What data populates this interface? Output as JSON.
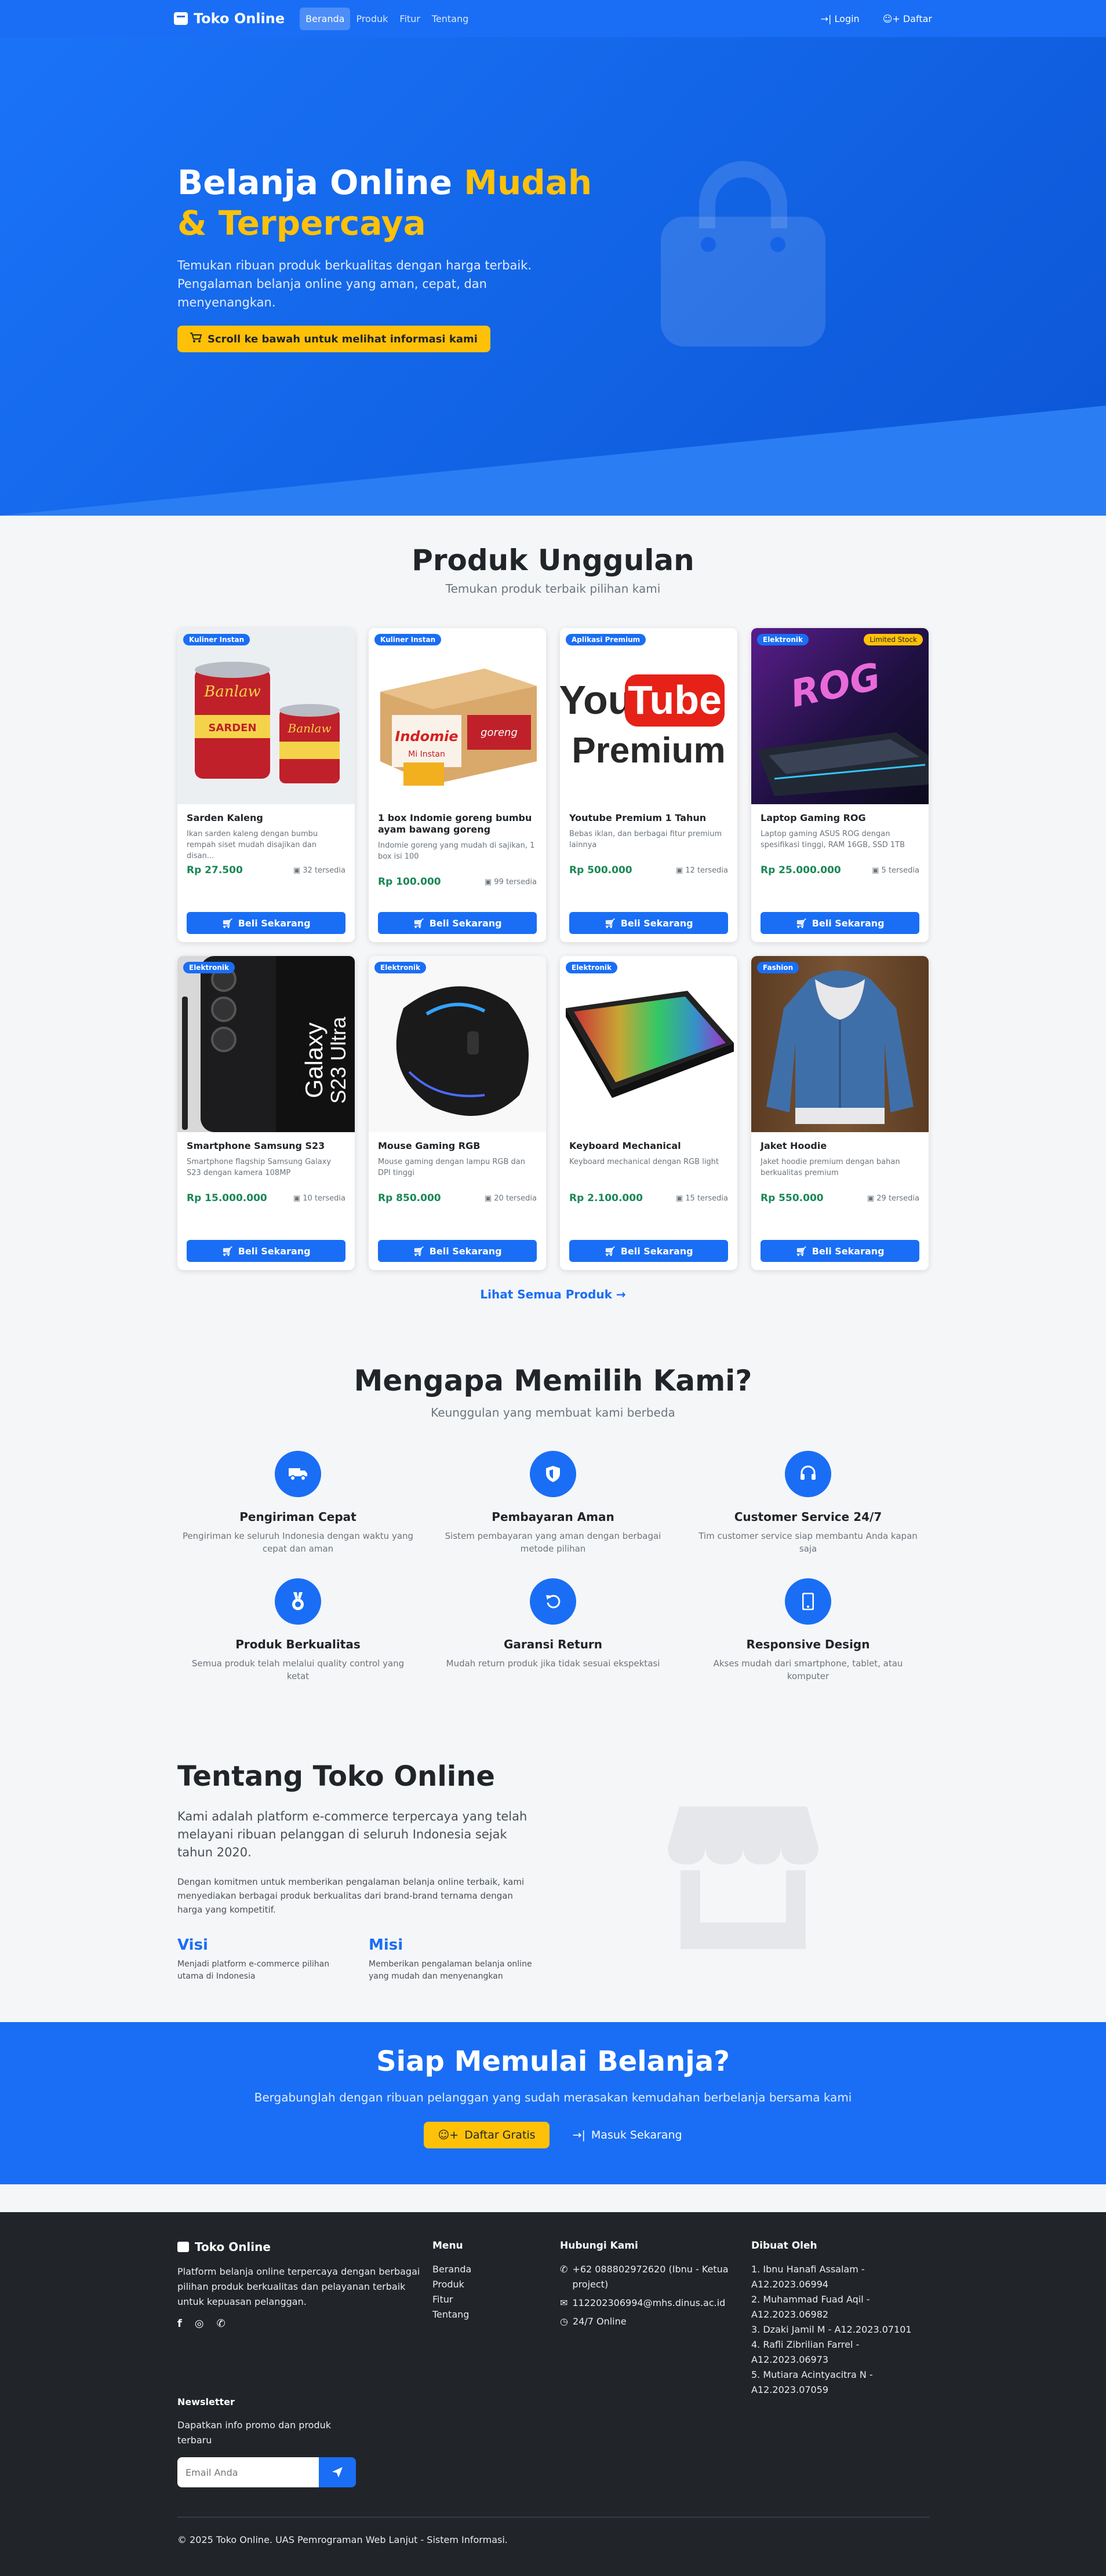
{
  "colors": {
    "primary": "#1a6ef5",
    "accent": "#ffc107",
    "dark": "#212529",
    "price": "#198754"
  },
  "nav": {
    "brand": "Toko Online",
    "links": [
      "Beranda",
      "Produk",
      "Fitur",
      "Tentang"
    ],
    "login": "Login",
    "register": "Daftar"
  },
  "hero": {
    "title_part1": "Belanja Online ",
    "title_highlight": "Mudah & Terpercaya",
    "subtitle": "Temukan ribuan produk berkualitas dengan harga terbaik. Pengalaman belanja online yang aman, cepat, dan menyenangkan.",
    "button": "Scroll ke bawah untuk melihat informasi kami"
  },
  "products": {
    "title": "Produk Unggulan",
    "subtitle": "Temukan produk terbaik pilihan kami",
    "buy_label": "Beli Sekarang",
    "see_all": "Lihat Semua Produk",
    "items": [
      {
        "name": "Sarden Kaleng",
        "category": "Kuliner Instan",
        "desc": "Ikan sarden kaleng dengan bumbu rempah siset mudah disajikan dan disan...",
        "price": "Rp 27.500",
        "stock": "32 tersedia"
      },
      {
        "name": "1 box Indomie goreng bumbu ayam bawang goreng",
        "category": "Kuliner Instan",
        "desc": "Indomie goreng yang mudah di sajikan, 1 box isi 100",
        "price": "Rp 100.000",
        "stock": "99 tersedia"
      },
      {
        "name": "Youtube Premium 1 Tahun",
        "category": "Aplikasi Premium",
        "desc": "Bebas iklan, dan berbagai fitur premium lainnya",
        "price": "Rp 500.000",
        "stock": "12 tersedia"
      },
      {
        "name": "Laptop Gaming ROG",
        "category": "Elektronik",
        "badge2": "Limited Stock",
        "desc": "Laptop gaming ASUS ROG dengan spesifikasi tinggi, RAM 16GB, SSD 1TB",
        "price": "Rp 25.000.000",
        "stock": "5 tersedia"
      },
      {
        "name": "Smartphone Samsung S23",
        "category": "Elektronik",
        "desc": "Smartphone flagship Samsung Galaxy S23 dengan kamera 108MP",
        "price": "Rp 15.000.000",
        "stock": "10 tersedia"
      },
      {
        "name": "Mouse Gaming RGB",
        "category": "Elektronik",
        "desc": "Mouse gaming dengan lampu RGB dan DPI tinggi",
        "price": "Rp 850.000",
        "stock": "20 tersedia"
      },
      {
        "name": "Keyboard Mechanical",
        "category": "Elektronik",
        "desc": "Keyboard mechanical dengan RGB light",
        "price": "Rp 2.100.000",
        "stock": "15 tersedia"
      },
      {
        "name": "Jaket Hoodie",
        "category": "Fashion",
        "desc": "Jaket hoodie premium dengan bahan berkualitas premium",
        "price": "Rp 550.000",
        "stock": "29 tersedia"
      }
    ],
    "image_text": {
      "sarden_brand": "Banlaw",
      "sarden_label": "SARDEN",
      "youtube_you": "You",
      "youtube_tube": "Tube",
      "youtube_premium": "Premium",
      "indomie_brand": "Indomie",
      "indomie_sub": "Mi Instan",
      "indomie_goreng": "goreng",
      "rog_text": "ROG",
      "galaxy_text": "Galaxy",
      "galaxy_model": "S23 Ultra"
    }
  },
  "why": {
    "title": "Mengapa Memilih Kami?",
    "subtitle": "Keunggulan yang membuat kami berbeda",
    "features": [
      {
        "title": "Pengiriman Cepat",
        "desc": "Pengiriman ke seluruh Indonesia dengan waktu yang cepat dan aman"
      },
      {
        "title": "Pembayaran Aman",
        "desc": "Sistem pembayaran yang aman dengan berbagai metode pilihan"
      },
      {
        "title": "Customer Service 24/7",
        "desc": "Tim customer service siap membantu Anda kapan saja"
      },
      {
        "title": "Produk Berkualitas",
        "desc": "Semua produk telah melalui quality control yang ketat"
      },
      {
        "title": "Garansi Return",
        "desc": "Mudah return produk jika tidak sesuai ekspektasi"
      },
      {
        "title": "Responsive Design",
        "desc": "Akses mudah dari smartphone, tablet, atau komputer"
      }
    ]
  },
  "about": {
    "title": "Tentang Toko Online",
    "lead": "Kami adalah platform e-commerce terpercaya yang telah melayani ribuan pelanggan di seluruh Indonesia sejak tahun 2020.",
    "text": "Dengan komitmen untuk memberikan pengalaman belanja online terbaik, kami menyediakan berbagai produk berkualitas dari brand-brand ternama dengan harga yang kompetitif.",
    "visi_title": "Visi",
    "visi": "Menjadi platform e-commerce pilihan utama di Indonesia",
    "misi_title": "Misi",
    "misi": "Memberikan pengalaman belanja online yang mudah dan menyenangkan"
  },
  "cta": {
    "title": "Siap Memulai Belanja?",
    "subtitle": "Bergabunglah dengan ribuan pelanggan yang sudah merasakan kemudahan berbelanja bersama kami",
    "register": "Daftar Gratis",
    "login": "Masuk Sekarang"
  },
  "footer": {
    "brand": "Toko Online",
    "desc": "Platform belanja online terpercaya dengan berbagai pilihan produk berkualitas dan pelayanan terbaik untuk kepuasan pelanggan.",
    "menu_title": "Menu",
    "menu": [
      "Beranda",
      "Produk",
      "Fitur",
      "Tentang"
    ],
    "contact_title": "Hubungi Kami",
    "phone": "+62 088802972620 (Ibnu - Ketua project)",
    "email": "112202306994@mhs.dinus.ac.id",
    "hours": "24/7 Online",
    "made_title": "Dibuat Oleh",
    "made": [
      "1. Ibnu Hanafi Assalam - A12.2023.06994",
      "2. Muhammad Fuad Aqil - A12.2023.06982",
      "3. Dzaki Jamil M - A12.2023.07101",
      "4. Rafli Zibrilian Farrel - A12.2023.06973",
      "5. Mutiara Acintyacitra N - A12.2023.07059"
    ],
    "newsletter_title": "Newsletter",
    "newsletter_desc": "Dapatkan info promo dan produk terbaru",
    "email_placeholder": "Email Anda",
    "copyright": "© 2025 Toko Online. UAS Pemrograman Web Lanjut - Sistem Informasi."
  }
}
